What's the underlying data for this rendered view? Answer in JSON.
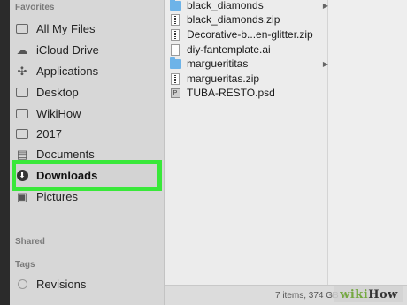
{
  "sidebar": {
    "favorites_title": "Favorites",
    "items": [
      {
        "label": "All My Files",
        "icon": "all-files-icon"
      },
      {
        "label": "iCloud Drive",
        "icon": "cloud-icon"
      },
      {
        "label": "Applications",
        "icon": "applications-icon"
      },
      {
        "label": "Desktop",
        "icon": "desktop-folder-icon"
      },
      {
        "label": "WikiHow",
        "icon": "folder-icon"
      },
      {
        "label": "2017",
        "icon": "folder-icon"
      },
      {
        "label": "Documents",
        "icon": "documents-icon"
      },
      {
        "label": "Downloads",
        "icon": "download-icon"
      },
      {
        "label": "Pictures",
        "icon": "pictures-icon"
      }
    ],
    "shared_title": "Shared",
    "tags_title": "Tags",
    "tags": [
      {
        "label": "Revisions"
      }
    ]
  },
  "files": [
    {
      "name": "black_diamonds",
      "kind": "folder"
    },
    {
      "name": "black_diamonds.zip",
      "kind": "zip"
    },
    {
      "name": "Decorative-b...en-glitter.zip",
      "kind": "zip"
    },
    {
      "name": "diy-fantemplate.ai",
      "kind": "doc"
    },
    {
      "name": "marguerititas",
      "kind": "folder"
    },
    {
      "name": "margueritas.zip",
      "kind": "zip"
    },
    {
      "name": "TUBA-RESTO.psd",
      "kind": "psd"
    }
  ],
  "status": {
    "text": "7 items, 374 GB a"
  },
  "watermark": {
    "part1": "wiki",
    "part2": "How"
  },
  "colors": {
    "highlight": "#39e83a",
    "folder": "#6db3e8"
  }
}
